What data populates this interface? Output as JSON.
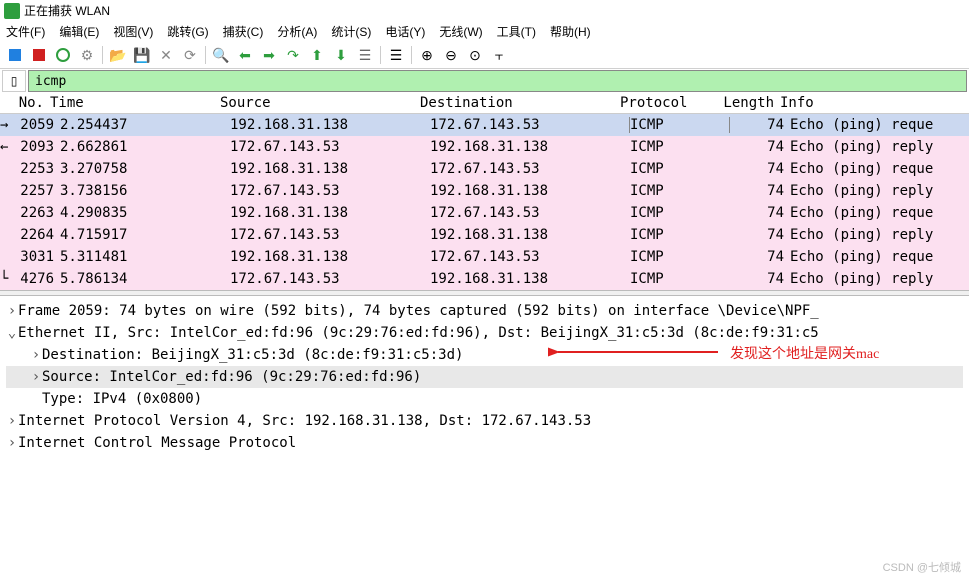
{
  "window_title": "正在捕获 WLAN",
  "menu": [
    "文件(F)",
    "编辑(E)",
    "视图(V)",
    "跳转(G)",
    "捕获(C)",
    "分析(A)",
    "统计(S)",
    "电话(Y)",
    "无线(W)",
    "工具(T)",
    "帮助(H)"
  ],
  "filter_value": "icmp",
  "columns": [
    "No.",
    "Time",
    "Source",
    "Destination",
    "Protocol",
    "Length",
    "Info"
  ],
  "rows": [
    {
      "no": "2059",
      "time": "2.254437",
      "src": "192.168.31.138",
      "dst": "172.67.143.53",
      "proto": "ICMP",
      "len": "74",
      "info": "Echo (ping) reque",
      "sel": true
    },
    {
      "no": "2093",
      "time": "2.662861",
      "src": "172.67.143.53",
      "dst": "192.168.31.138",
      "proto": "ICMP",
      "len": "74",
      "info": "Echo (ping) reply",
      "m": "←"
    },
    {
      "no": "2253",
      "time": "3.270758",
      "src": "192.168.31.138",
      "dst": "172.67.143.53",
      "proto": "ICMP",
      "len": "74",
      "info": "Echo (ping) reque"
    },
    {
      "no": "2257",
      "time": "3.738156",
      "src": "172.67.143.53",
      "dst": "192.168.31.138",
      "proto": "ICMP",
      "len": "74",
      "info": "Echo (ping) reply"
    },
    {
      "no": "2263",
      "time": "4.290835",
      "src": "192.168.31.138",
      "dst": "172.67.143.53",
      "proto": "ICMP",
      "len": "74",
      "info": "Echo (ping) reque"
    },
    {
      "no": "2264",
      "time": "4.715917",
      "src": "172.67.143.53",
      "dst": "192.168.31.138",
      "proto": "ICMP",
      "len": "74",
      "info": "Echo (ping) reply"
    },
    {
      "no": "3031",
      "time": "5.311481",
      "src": "192.168.31.138",
      "dst": "172.67.143.53",
      "proto": "ICMP",
      "len": "74",
      "info": "Echo (ping) reque"
    },
    {
      "no": "4276",
      "time": "5.786134",
      "src": "172.67.143.53",
      "dst": "192.168.31.138",
      "proto": "ICMP",
      "len": "74",
      "info": "Echo (ping) reply",
      "last": true
    }
  ],
  "details": {
    "frame": "Frame 2059: 74 bytes on wire (592 bits), 74 bytes captured (592 bits) on interface \\Device\\NPF_",
    "eth": "Ethernet II, Src: IntelCor_ed:fd:96 (9c:29:76:ed:fd:96), Dst: BeijingX_31:c5:3d (8c:de:f9:31:c5",
    "eth_dst": "Destination: BeijingX_31:c5:3d (8c:de:f9:31:c5:3d)",
    "eth_src": "Source: IntelCor_ed:fd:96 (9c:29:76:ed:fd:96)",
    "eth_type": "Type: IPv4 (0x0800)",
    "ip": "Internet Protocol Version 4, Src: 192.168.31.138, Dst: 172.67.143.53",
    "icmp": "Internet Control Message Protocol"
  },
  "annotation": "发现这个地址是网关mac",
  "watermark": "CSDN @七倾城"
}
